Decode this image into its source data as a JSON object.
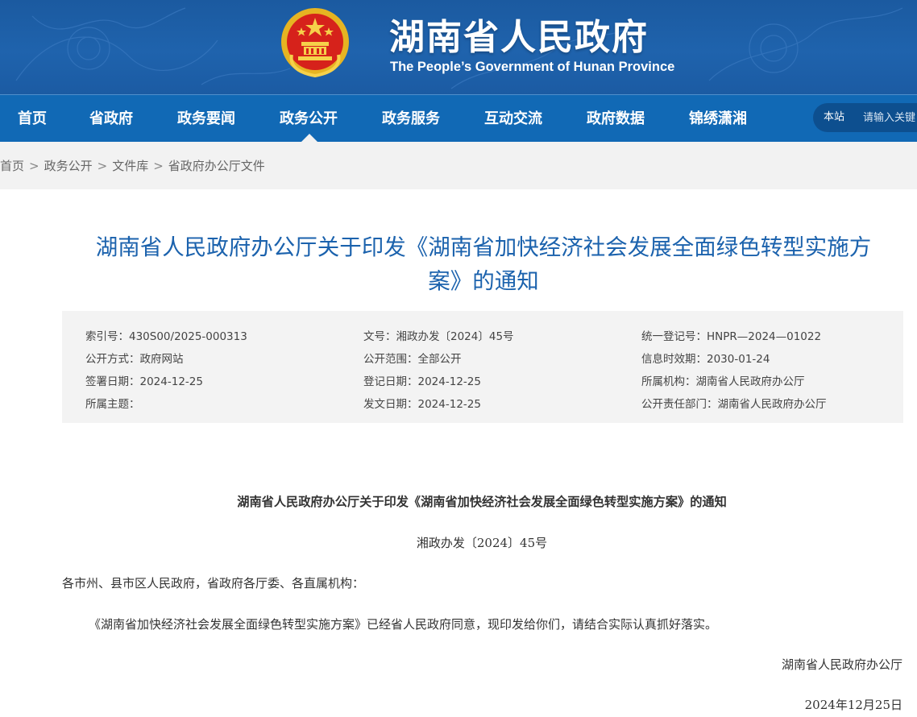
{
  "header": {
    "site_title": "湖南省人民政府",
    "site_subtitle": "The People’s Government of Hunan Province"
  },
  "nav": {
    "items": [
      {
        "label": "首页"
      },
      {
        "label": "省政府"
      },
      {
        "label": "政务要闻"
      },
      {
        "label": "政务公开",
        "active": true
      },
      {
        "label": "政务服务"
      },
      {
        "label": "互动交流"
      },
      {
        "label": "政府数据"
      },
      {
        "label": "锦绣潇湘"
      }
    ],
    "search": {
      "scope_label": "本站",
      "placeholder": "请输入关键"
    }
  },
  "breadcrumb": {
    "items": [
      "首页",
      "政务公开",
      "文件库",
      "省政府办公厅文件"
    ],
    "separator": ">"
  },
  "article": {
    "title_line1": "湖南省人民政府办公厅关于印发《湖南省加快经济社会发展全面绿色转型实施方",
    "title_line2": "案》的通知"
  },
  "meta": {
    "index_no": "索引号：430S00/2025-000313",
    "doc_no": "文号：湘政办发〔2024〕45号",
    "unified_reg_no": "统一登记号：HNPR—2024—01022",
    "disclosure_method": "公开方式：政府网站",
    "disclosure_scope": "公开范围：全部公开",
    "valid_until": "信息时效期：2030-01-24",
    "signed_date": "签署日期：2024-12-25",
    "register_date": "登记日期：2024-12-25",
    "agency": "所属机构：湖南省人民政府办公厅",
    "topic": "所属主题：",
    "issue_date": "发文日期：2024-12-25",
    "responsible_dept": "公开责任部门：湖南省人民政府办公厅"
  },
  "body": {
    "heading": "湖南省人民政府办公厅关于印发《湖南省加快经济社会发展全面绿色转型实施方案》的通知",
    "doc_number": "湘政办发〔2024〕45号",
    "salutation": "各市州、县市区人民政府，省政府各厅委、各直属机构：",
    "paragraph": "《湖南省加快经济社会发展全面绿色转型实施方案》已经省人民政府同意，现印发给你们，请结合实际认真抓好落实。",
    "signature": "湖南省人民政府办公厅",
    "date": "2024年12月25日"
  },
  "colors": {
    "banner": "#1f63ad",
    "nav": "#1169b5",
    "title": "#1b62ad",
    "meta_bg": "#f3f3f3",
    "breadcrumb_bg": "#f2f2f2"
  },
  "icons": {
    "emblem": "national-emblem-icon"
  }
}
